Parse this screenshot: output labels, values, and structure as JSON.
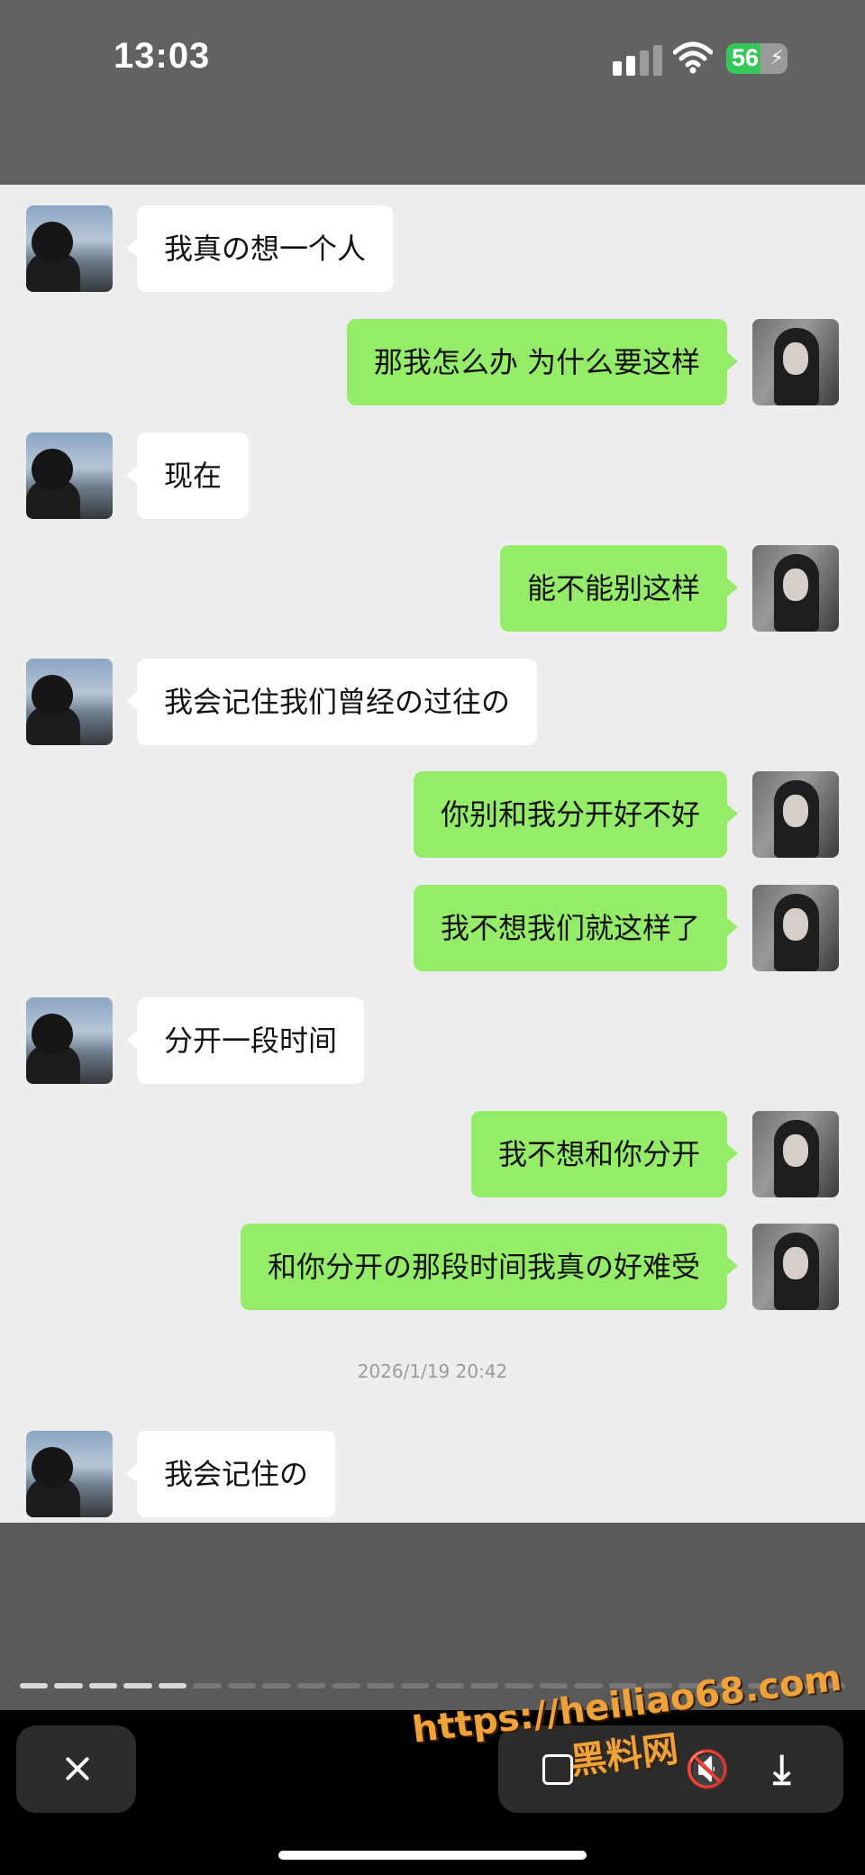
{
  "status_bar": {
    "time": "13:03",
    "battery_level": "56",
    "battery_fraction": 0.56,
    "signal_bars_active": 2,
    "signal_bars_total": 4,
    "icons": [
      "cellular-signal-icon",
      "wifi-icon",
      "battery-charging-icon"
    ]
  },
  "chat": {
    "messages": [
      {
        "side": "left",
        "text": "我真の想一个人"
      },
      {
        "side": "right",
        "text": "那我怎么办 为什么要这样"
      },
      {
        "side": "left",
        "text": "现在"
      },
      {
        "side": "right",
        "text": "能不能别这样"
      },
      {
        "side": "left",
        "text": "我会记住我们曾经の过往の"
      },
      {
        "side": "right",
        "text": "你别和我分开好不好"
      },
      {
        "side": "right",
        "text": "我不想我们就这样了"
      },
      {
        "side": "left",
        "text": "分开一段时间"
      },
      {
        "side": "right",
        "text": "我不想和你分开"
      },
      {
        "side": "right",
        "text": "和你分开の那段时间我真の好难受"
      },
      {
        "side": "left",
        "text": "我会记住の"
      }
    ],
    "timestamp": "2026/1/19 20:42",
    "colors": {
      "background": "#ededed",
      "left_bubble": "#ffffff",
      "right_bubble": "#95ec69"
    }
  },
  "viewer": {
    "progress_segments_total": 24,
    "progress_segments_viewed": 5,
    "buttons": [
      "close-icon",
      "scan-icon",
      "mute-icon",
      "download-icon"
    ]
  },
  "watermark": {
    "url": "https://heiliao68.com",
    "name": "黑料网",
    "color": "#f0a23a"
  }
}
